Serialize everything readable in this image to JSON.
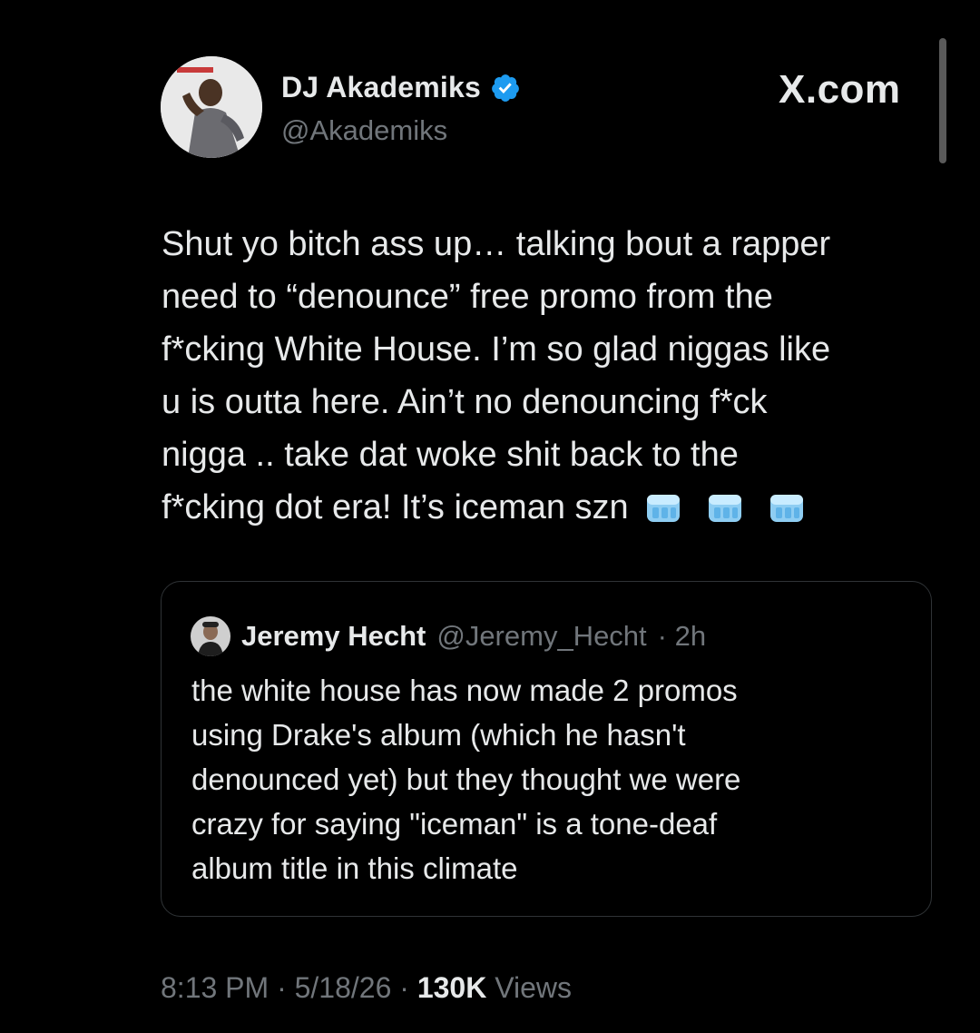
{
  "author": {
    "display_name": "DJ Akademiks",
    "handle": "@Akademiks",
    "verified": true,
    "verified_color": "#1d9bf0"
  },
  "brand": {
    "label": "X.com"
  },
  "tweet": {
    "text": "Shut yo bitch ass up… talking bout a rapper\nneed to “denounce” free promo from the\nf*cking White House. I’m so glad niggas like\nu is outta here. Ain’t no denouncing f*ck\nnigga .. take dat woke shit back to the\nf*cking dot era! It’s iceman szn",
    "emojis": [
      "ice-cube-icon",
      "ice-cube-icon",
      "ice-cube-icon"
    ]
  },
  "quote": {
    "display_name": "Jeremy Hecht",
    "handle": "@Jeremy_Hecht",
    "time": "· 2h",
    "text": "the white house has now made 2 promos\nusing Drake's album (which he hasn't\ndenounced yet) but they thought we were\ncrazy for saying \"iceman\" is a tone-deaf\nalbum title in this climate"
  },
  "meta": {
    "time": "8:13 PM",
    "date": "· 5/18/26 ·",
    "views_count": "130K",
    "views_label": "Views"
  },
  "colors": {
    "background": "#000000",
    "text": "#e7e9ea",
    "muted": "#71767b",
    "border": "#2f3336"
  }
}
